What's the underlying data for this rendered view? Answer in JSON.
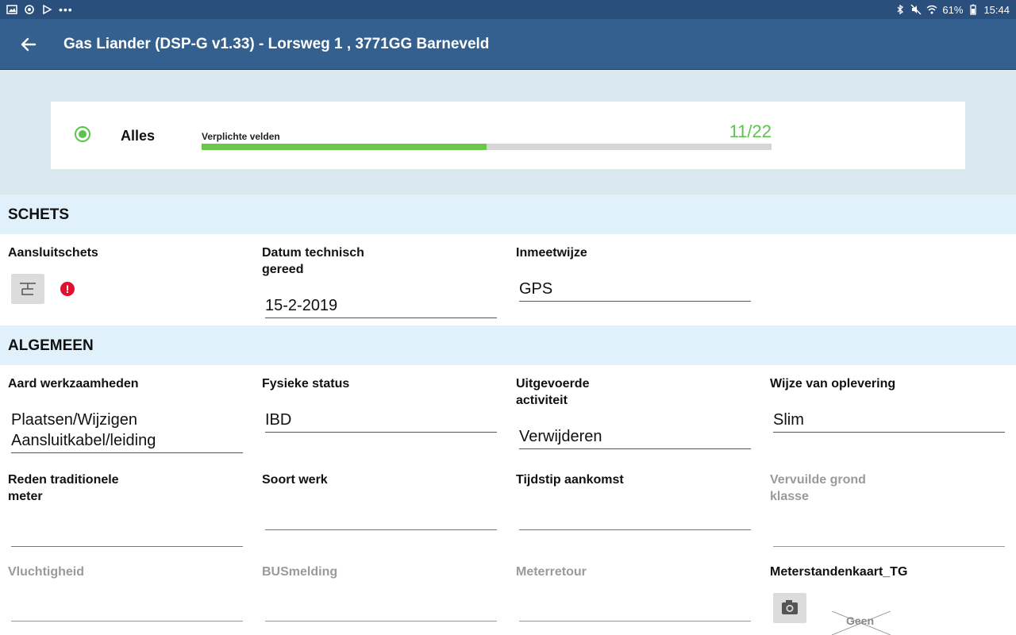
{
  "status_bar": {
    "battery": "61%",
    "time": "15:44",
    "icons": [
      "image-icon",
      "sync-icon",
      "play-store-icon",
      "more-icon",
      "bluetooth-icon",
      "mute-icon",
      "wifi-icon",
      "battery-icon"
    ]
  },
  "app_bar": {
    "title": "Gas Liander (DSP-G v1.33) - Lorsweg 1 , 3771GG Barneveld"
  },
  "progress": {
    "filter_label": "Alles",
    "required_label": "Verplichte velden",
    "count_text": "11/22",
    "completed": 11,
    "total": 22,
    "accent_color": "#5cc44c"
  },
  "sections": {
    "schets": {
      "title": "SCHETS",
      "fields": {
        "aansluitschets": {
          "label": "Aansluitschets"
        },
        "datum": {
          "label_line1": "Datum technisch",
          "label_line2": "gereed",
          "value": "15-2-2019"
        },
        "inmeetwijze": {
          "label": "Inmeetwijze",
          "value": "GPS"
        }
      }
    },
    "algemeen": {
      "title": "ALGEMEEN",
      "fields": {
        "aard": {
          "label": "Aard werkzaamheden",
          "value_line1": "Plaatsen/Wijzigen",
          "value_line2": "Aansluitkabel/leiding"
        },
        "fysieke": {
          "label": "Fysieke status",
          "value": "IBD"
        },
        "uitgevoerde": {
          "label_line1": "Uitgevoerde",
          "label_line2": "activiteit",
          "value": "Verwijderen"
        },
        "wijze": {
          "label": "Wijze van oplevering",
          "value": "Slim"
        },
        "reden": {
          "label_line1": "Reden traditionele",
          "label_line2": "meter",
          "value": ""
        },
        "soort": {
          "label": "Soort werk",
          "value": ""
        },
        "tijdstip": {
          "label": "Tijdstip aankomst",
          "value": ""
        },
        "vervuilde": {
          "label_line1": "Vervuilde grond",
          "label_line2": "klasse",
          "value": ""
        },
        "vluchtigheid": {
          "label": "Vluchtigheid",
          "value": ""
        },
        "busmelding": {
          "label": "BUSmelding",
          "value": ""
        },
        "meterretour": {
          "label": "Meterretour",
          "value": ""
        },
        "meterstanden": {
          "label": "Meterstandenkaart_TG",
          "photo_text": "Geen"
        }
      }
    }
  }
}
